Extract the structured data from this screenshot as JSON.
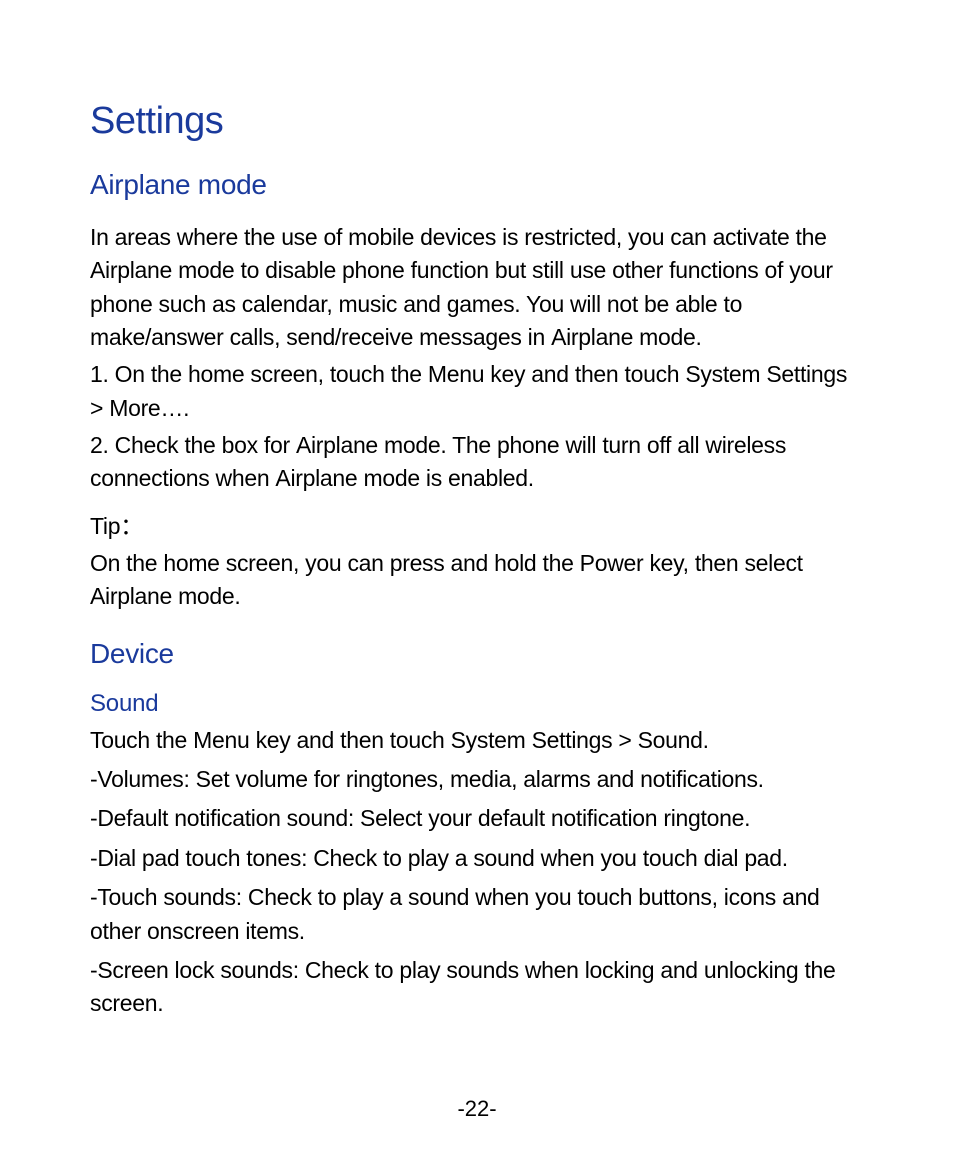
{
  "page_number": "-22-",
  "title": "Settings",
  "sections": {
    "airplane": {
      "heading": "Airplane mode",
      "intro": {
        "p1a": "In areas where the use of mobile devices is restricted, you can activate the ",
        "p1b": "Airplane mode",
        "p1c": " to disable phone function but still use other functions of your phone such as calendar, music and games. You will not be able to make/answer calls, send/receive messages in ",
        "p1d": "Airplane mode",
        "p1e": "."
      },
      "step1": {
        "a": "1. On the home screen, touch the ",
        "b": "Menu",
        "c": " key and then touch ",
        "d": "System Settings > More…",
        "e": "."
      },
      "step2": {
        "a": "2. Check the box for ",
        "b": "Airplane mode",
        "c": ". The phone will turn off all wireless connections when ",
        "d": "Airplane mode",
        "e": " is enabled."
      },
      "tip": {
        "label": "Tip：",
        "a": "On the home screen, you can press and hold the ",
        "b": "Power",
        "c": " key, then select ",
        "d": "Airplane mode",
        "e": "."
      }
    },
    "device": {
      "heading": "Device",
      "sound": {
        "heading": "Sound",
        "intro": {
          "a": "Touch the ",
          "b": "Menu",
          "c": " key and then touch ",
          "d": "System Settings > Sound",
          "e": "."
        },
        "items": {
          "volumes": {
            "label": "Volumes",
            "text": ": Set volume for ringtones, media, alarms and notifications."
          },
          "notif": {
            "label": "Default notification sound",
            "text": ": Select your default notification ringtone."
          },
          "dialpad": {
            "label": "Dial pad touch tones",
            "text": ": Check to play a sound when you touch dial pad."
          },
          "touch": {
            "label": "Touch sounds",
            "text": ": Check to play a sound when you touch buttons, icons and other onscreen items."
          },
          "lock": {
            "label": "Screen lock sounds",
            "text": ": Check to play sounds when locking and unlocking the screen."
          }
        },
        "dash": "-"
      }
    }
  }
}
